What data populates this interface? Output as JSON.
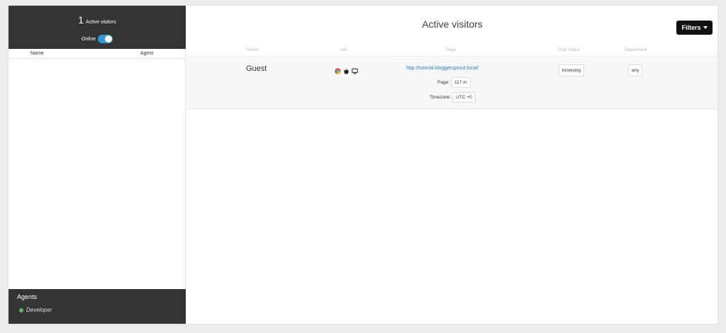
{
  "sidebar": {
    "visitor_count": "1",
    "visitor_label": "Active visitors",
    "online_label": "Online",
    "online_toggle_on": true,
    "columns": {
      "name": "Name",
      "agent": "Agent"
    }
  },
  "agents": {
    "title": "Agents",
    "items": [
      {
        "name": "Developer",
        "status": "online"
      }
    ]
  },
  "main": {
    "title": "Active visitors",
    "filters_label": "Filters",
    "columns": {
      "visitor": "Visitor",
      "info": "Info",
      "page": "Page",
      "chat_status": "Chat Status",
      "department": "Department"
    },
    "rows": [
      {
        "visitor": "Guest",
        "info_icons": [
          "chrome-icon",
          "apple-icon",
          "desktop-icon"
        ],
        "page_url": "http://tutorial-bloggersprout.local/",
        "page_label": "Page:",
        "page_time": "117 m",
        "timezone_label": "Timezone:",
        "timezone_value": "UTC +0",
        "chat_status": "browsing",
        "department": "any"
      }
    ]
  },
  "colors": {
    "dark_panel": "#343434",
    "toggle": "#2d9ad6",
    "link": "#2a7fc1",
    "online_dot": "#5cb85c"
  }
}
